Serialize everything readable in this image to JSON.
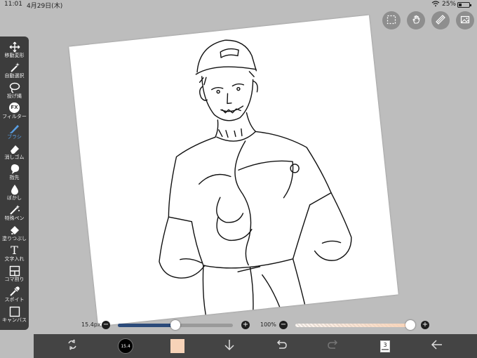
{
  "status_bar": {
    "time": "11:01",
    "date": "4月29日(木)",
    "battery": "25%",
    "battery_level": 0.25
  },
  "top_buttons": [
    {
      "icon": "selection-icon"
    },
    {
      "icon": "hand-icon"
    },
    {
      "icon": "ruler-icon"
    },
    {
      "icon": "image-icon"
    }
  ],
  "tools": [
    {
      "label": "移動変形",
      "icon": "move-icon"
    },
    {
      "label": "自動選択",
      "icon": "magic-wand-icon"
    },
    {
      "label": "投げ縄",
      "icon": "lasso-icon"
    },
    {
      "label": "フィルター",
      "icon": "fx-icon",
      "icon_text": "FX"
    },
    {
      "label": "ブラシ",
      "icon": "brush-icon",
      "active": true
    },
    {
      "label": "消しゴム",
      "icon": "eraser-icon"
    },
    {
      "label": "指先",
      "icon": "smudge-icon"
    },
    {
      "label": "ぼかし",
      "icon": "blur-icon"
    },
    {
      "label": "特殊ペン",
      "icon": "special-pen-icon"
    },
    {
      "label": "塗りつぶし",
      "icon": "fill-icon"
    },
    {
      "label": "文字入れ",
      "icon": "text-icon",
      "icon_text": "T"
    },
    {
      "label": "コマ割り",
      "icon": "frame-divider-icon"
    },
    {
      "label": "スポイト",
      "icon": "eyedropper-icon"
    },
    {
      "label": "キャンバス",
      "icon": "canvas-icon"
    }
  ],
  "brush": {
    "size_label": "15.4px",
    "size_fraction": 0.5,
    "opacity_label": "100%",
    "opacity_fraction": 1.0,
    "minus": "−",
    "plus": "+"
  },
  "bottom_bar": {
    "brush_preview_text": "15.4",
    "color": "#f7d3b8",
    "layer_count": "3"
  },
  "colors": {
    "toolbar_bg": "#3c3c3c",
    "bottom_bar_bg": "#444444",
    "slider_blue": "#2b4a7a",
    "accent_active": "#5aa0e6"
  }
}
